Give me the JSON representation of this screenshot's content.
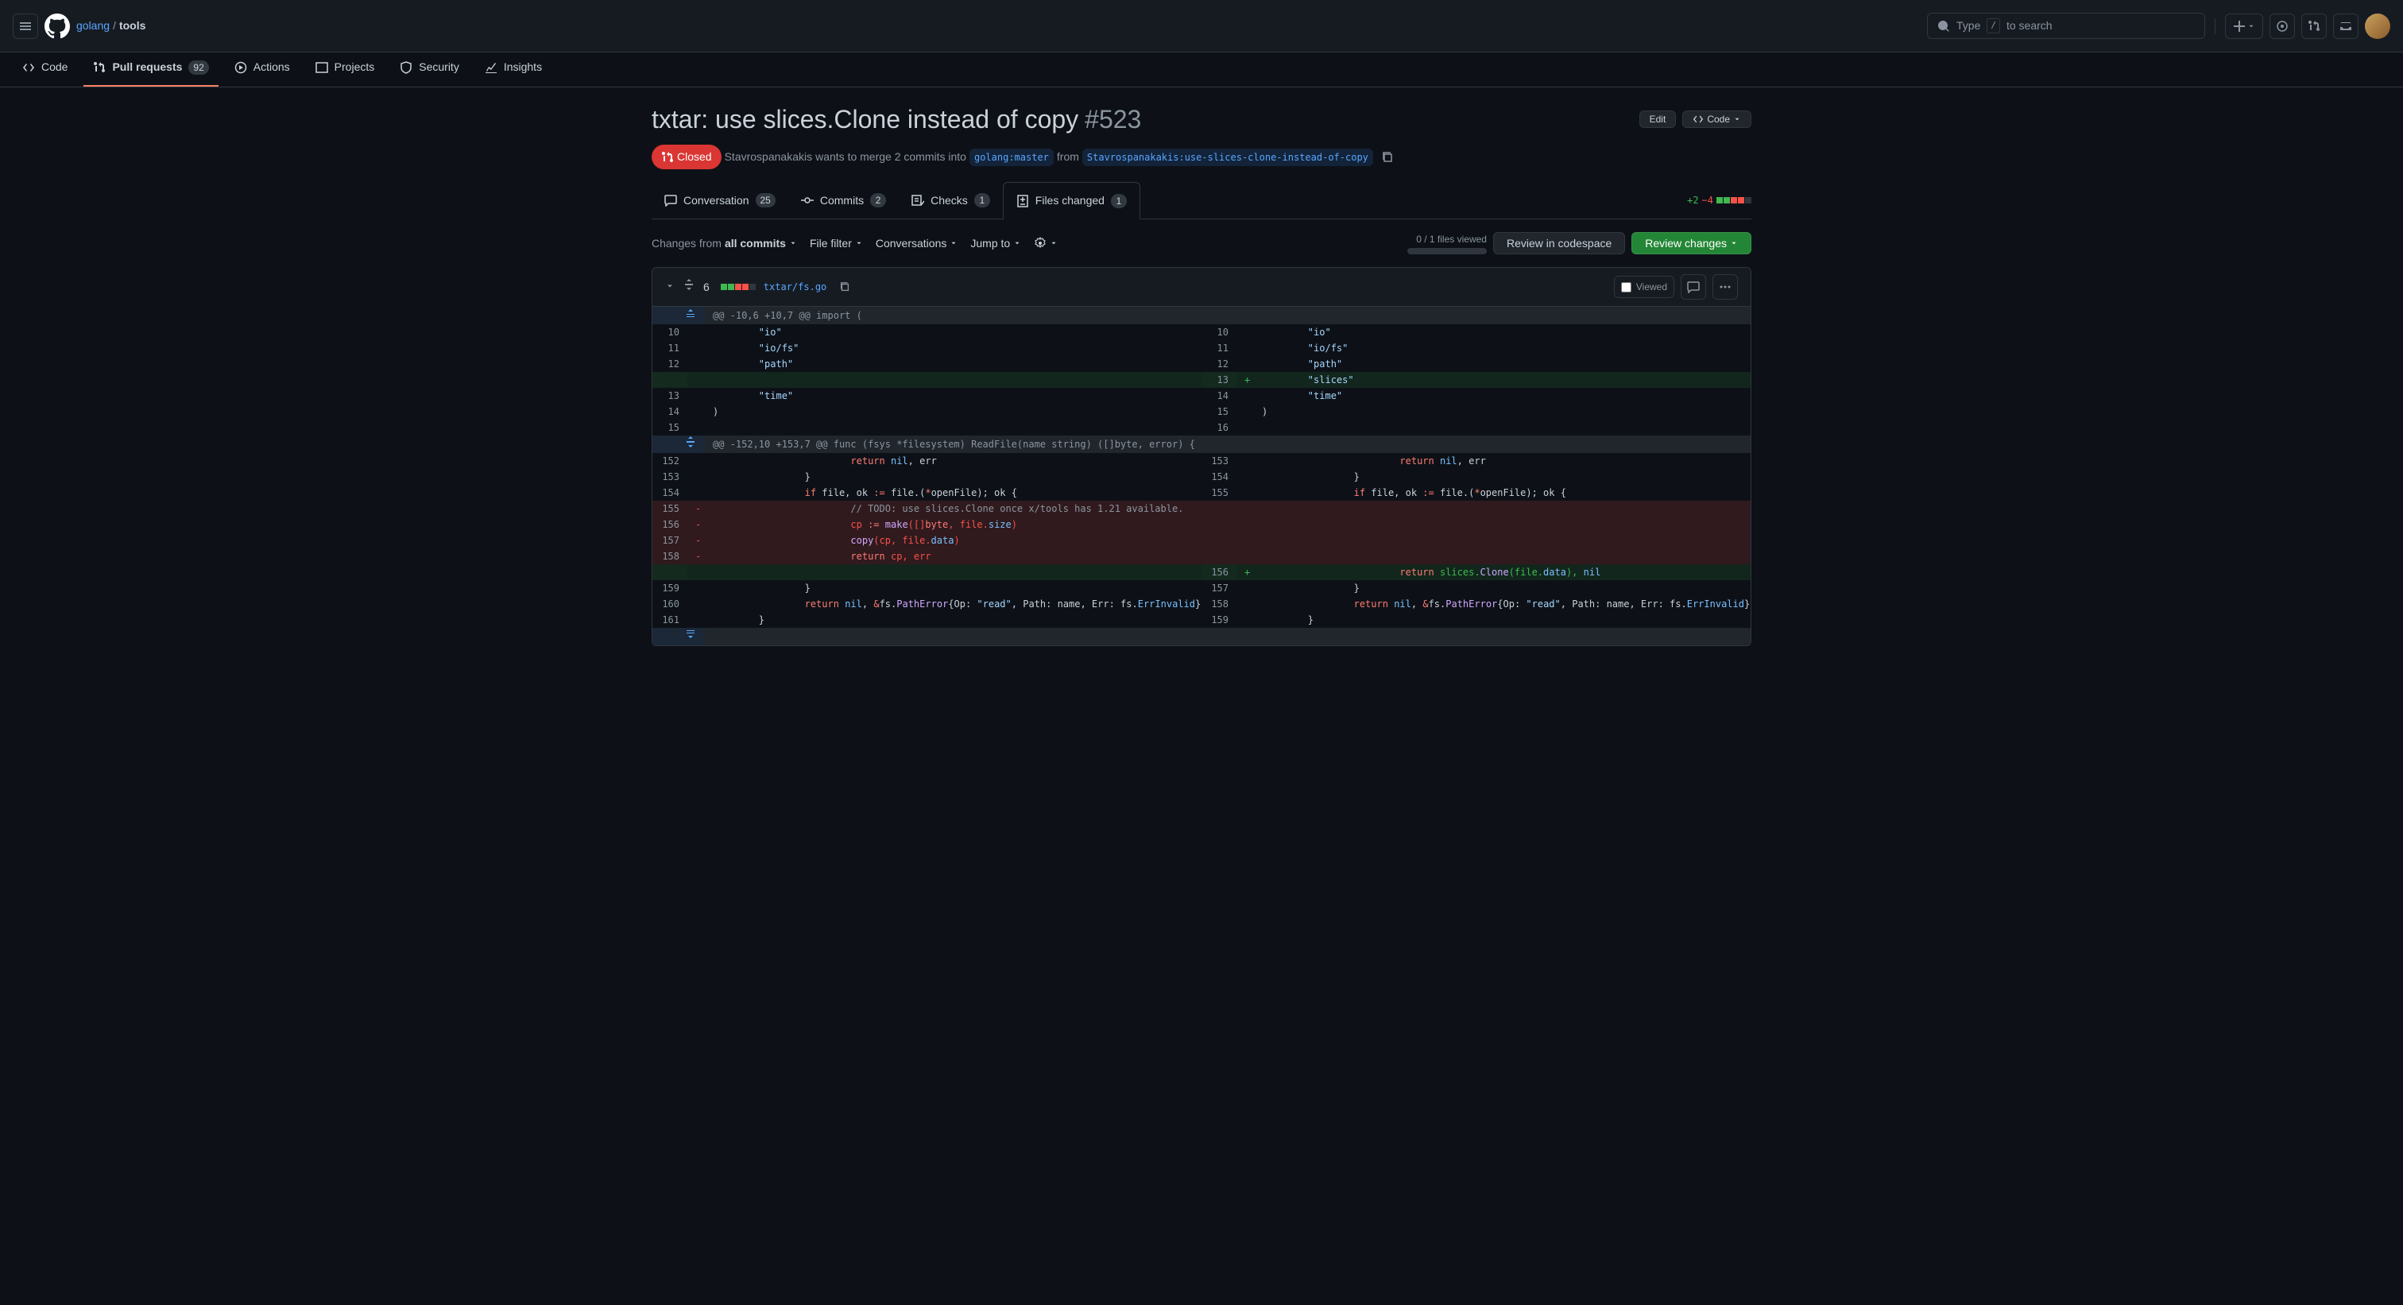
{
  "breadcrumb": {
    "owner": "golang",
    "repo": "tools"
  },
  "search": {
    "placeholder": "to search",
    "prefix": "Type",
    "kbd": "/"
  },
  "repotabs": [
    {
      "label": "Code"
    },
    {
      "label": "Pull requests",
      "count": "92",
      "selected": true
    },
    {
      "label": "Actions"
    },
    {
      "label": "Projects"
    },
    {
      "label": "Security"
    },
    {
      "label": "Insights"
    }
  ],
  "pr": {
    "title": "txtar: use slices.Clone instead of copy",
    "number": "#523",
    "state": "Closed",
    "author": "Stavrospanakakis",
    "wants": " wants to merge 2 commits into ",
    "base": "golang:master",
    "from": " from ",
    "head": "Stavrospanakakis:use-slices-clone-instead-of-copy",
    "edit": "Edit",
    "code": "Code"
  },
  "prtabs": {
    "conversation": {
      "label": "Conversation",
      "count": "25"
    },
    "commits": {
      "label": "Commits",
      "count": "2"
    },
    "checks": {
      "label": "Checks",
      "count": "1"
    },
    "files": {
      "label": "Files changed",
      "count": "1"
    }
  },
  "diffstat": {
    "add": "+2",
    "del": "−4"
  },
  "toolbar": {
    "changesFrom": "Changes from",
    "allCommits": "all commits",
    "fileFilter": "File filter",
    "conversations": "Conversations",
    "jumpTo": "Jump to",
    "viewedCount": "0 / 1 files viewed",
    "reviewCodespace": "Review in codespace",
    "reviewChanges": "Review changes"
  },
  "file": {
    "changes": "6",
    "path": "txtar/fs.go",
    "viewed": "Viewed"
  },
  "hunk1": "@@ -10,6 +10,7 @@ import (",
  "hunk2": "@@ -152,10 +153,7 @@ func (fsys *filesystem) ReadFile(name string) ([]byte, error) {",
  "l": {
    "io": "\t\"io\"",
    "iofs": "\t\"io/fs\"",
    "path": "\t\"path\"",
    "slices": "\t\"slices\"",
    "time": "\t\"time\"",
    "paren": ")",
    "blank": "",
    "retnilerr": "\t\t\treturn nil, err",
    "brace": "\t\t}",
    "iffile": "\t\tif file, ok := file.(*openFile); ok {",
    "todo": "\t\t\t// TODO: use slices.Clone once x/tools has 1.21 available.",
    "cp": "\t\t\tcp := make([]byte, file.size)",
    "copy": "\t\t\tcopy(cp, file.data)",
    "retcp": "\t\t\treturn cp, err",
    "retslice": "\t\t\treturn slices.Clone(file.data), nil",
    "retpath": "\t\treturn nil, &fs.PathError{Op: \"read\", Path: name, Err: fs.ErrInvalid}",
    "brace2": "\t}"
  },
  "n": {
    "l10": "10",
    "l11": "11",
    "l12": "12",
    "l13": "13",
    "l14": "14",
    "l15": "15",
    "l16": "16",
    "l152": "152",
    "l153": "153",
    "l154": "154",
    "l155": "155",
    "l156": "156",
    "l157": "157",
    "l158": "158",
    "l159": "159",
    "l160": "160",
    "l161": "161"
  }
}
